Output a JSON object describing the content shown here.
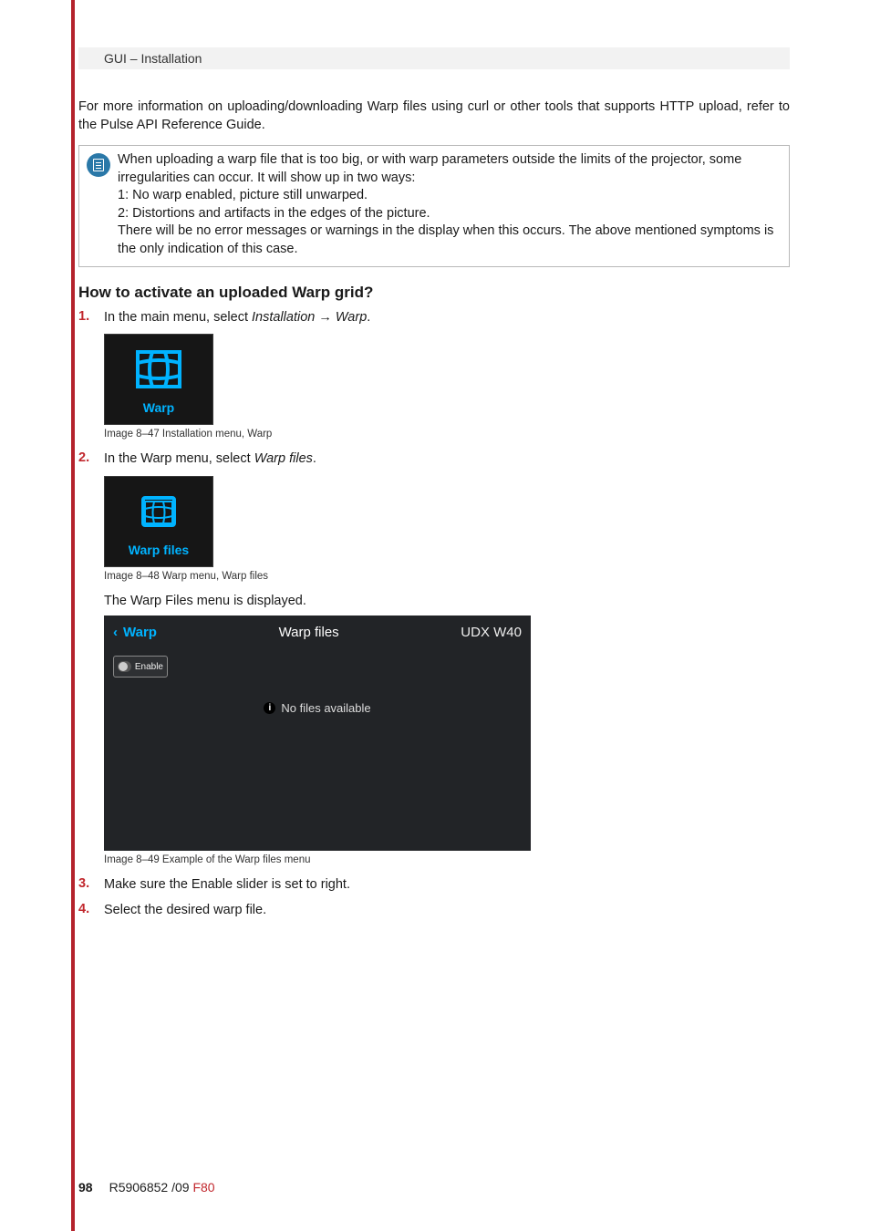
{
  "header": {
    "breadcrumb": "GUI – Installation"
  },
  "intro_paragraph": "For more information on uploading/downloading Warp files using curl or other tools that supports HTTP upload, refer to the Pulse API Reference Guide.",
  "note": {
    "line1": "When uploading a warp file that is too big, or with warp parameters outside the limits of the projector, some irregularities can occur. It will show up in two ways:",
    "line2": "1: No warp enabled, picture still unwarped.",
    "line3": "2: Distortions and artifacts in the edges of the picture.",
    "line4": "There will be no error messages or warnings in the display when this occurs. The above mentioned symptoms is the only indication of this case."
  },
  "heading": "How to activate an uploaded Warp grid?",
  "steps": {
    "s1": {
      "num": "1.",
      "pre": "In the main menu, select ",
      "italic": "Installation → Warp",
      "post": "."
    },
    "s2": {
      "num": "2.",
      "pre": "In the Warp menu, select ",
      "italic": "Warp files",
      "post": "."
    },
    "s2b": "The Warp Files menu is displayed.",
    "s3": {
      "num": "3.",
      "text": "Make sure the Enable slider is set to right."
    },
    "s4": {
      "num": "4.",
      "text": "Select the desired warp file."
    }
  },
  "fig47": {
    "label": "Warp",
    "caption": "Image 8–47  Installation menu, Warp"
  },
  "fig48": {
    "label": "Warp files",
    "caption": "Image 8–48  Warp menu, Warp files"
  },
  "fig49": {
    "back_label": "Warp",
    "title": "Warp files",
    "device": "UDX W40",
    "enable_label": "Enable",
    "empty_text": "No files available",
    "caption": "Image 8–49  Example of the Warp files menu"
  },
  "footer": {
    "page": "98",
    "code": "R5906852 /09 ",
    "model": "F80"
  }
}
